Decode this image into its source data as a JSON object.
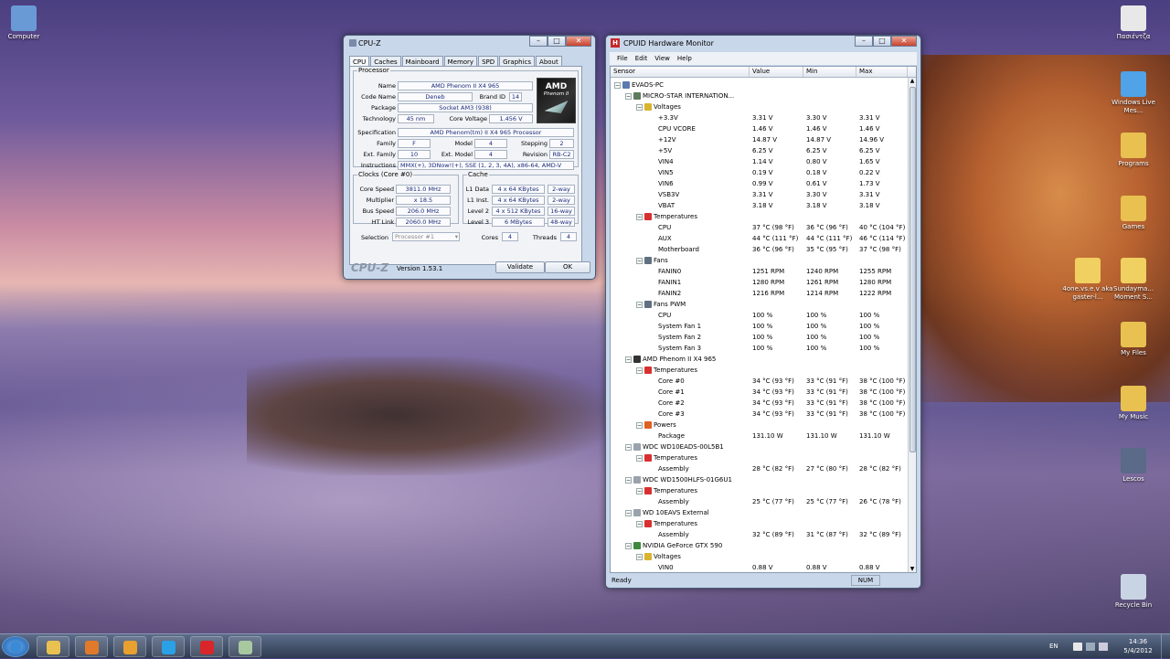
{
  "desktop": {
    "icons": [
      {
        "label": "Computer",
        "color": "#6a9ad6"
      },
      {
        "label": "Πασιέντζα",
        "color": "#e8e8e8"
      },
      {
        "label": "Windows Live Mes...",
        "color": "#4fa3e6"
      },
      {
        "label": "Programs",
        "color": "#e8c150"
      },
      {
        "label": "Games",
        "color": "#e8c150"
      },
      {
        "label": "4one.vs.e.v aka gaster-l...",
        "color": "#f0d060"
      },
      {
        "label": "Sundayma... Moment S...",
        "color": "#f0d060"
      },
      {
        "label": "My Files",
        "color": "#e8c150"
      },
      {
        "label": "My Music",
        "color": "#e8c150"
      },
      {
        "label": "Lescos",
        "color": "#5a6a88"
      },
      {
        "label": "Recycle Bin",
        "color": "#c8d4e4"
      }
    ]
  },
  "cpuz": {
    "title": "CPU-Z",
    "tabs": [
      "CPU",
      "Caches",
      "Mainboard",
      "Memory",
      "SPD",
      "Graphics",
      "About"
    ],
    "processor_legend": "Processor",
    "labels": {
      "name": "Name",
      "code_name": "Code Name",
      "brand_id": "Brand ID",
      "package": "Package",
      "technology": "Technology",
      "core_voltage": "Core Voltage",
      "specification": "Specification",
      "family": "Family",
      "model": "Model",
      "stepping": "Stepping",
      "ext_family": "Ext. Family",
      "ext_model": "Ext. Model",
      "revision": "Revision",
      "instructions": "Instructions"
    },
    "values": {
      "name": "AMD Phenom II X4 965",
      "code_name": "Deneb",
      "brand_id": "14",
      "package": "Socket AM3 (938)",
      "technology": "45 nm",
      "core_voltage": "1.456 V",
      "specification": "AMD Phenom(tm) II X4 965 Processor",
      "family": "F",
      "model": "4",
      "stepping": "2",
      "ext_family": "10",
      "ext_model": "4",
      "revision": "RB-C2",
      "instructions": "MMX(+), 3DNow!(+), SSE (1, 2, 3, 4A), x86-64, AMD-V"
    },
    "logo": {
      "line1": "AMD",
      "line2": "Phenom II"
    },
    "clocks_legend": "Clocks (Core #0)",
    "clock_labels": {
      "core_speed": "Core Speed",
      "multiplier": "Multiplier",
      "bus_speed": "Bus Speed",
      "ht_link": "HT Link"
    },
    "clock_values": {
      "core_speed": "3811.0 MHz",
      "multiplier": "x 18.5",
      "bus_speed": "206.0 MHz",
      "ht_link": "2060.0 MHz"
    },
    "cache_legend": "Cache",
    "cache_rows": [
      {
        "label": "L1 Data",
        "size": "4 x 64 KBytes",
        "way": "2-way"
      },
      {
        "label": "L1 Inst.",
        "size": "4 x 64 KBytes",
        "way": "2-way"
      },
      {
        "label": "Level 2",
        "size": "4 x 512 KBytes",
        "way": "16-way"
      },
      {
        "label": "Level 3",
        "size": "6 MBytes",
        "way": "48-way"
      }
    ],
    "selection_label": "Selection",
    "selection_value": "Processor #1",
    "cores_label": "Cores",
    "cores_value": "4",
    "threads_label": "Threads",
    "threads_value": "4",
    "brand": "CPU-Z",
    "version": "Version 1.53.1",
    "validate": "Validate",
    "ok": "OK"
  },
  "hwmon": {
    "title": "CPUID Hardware Monitor",
    "menu": [
      "File",
      "Edit",
      "View",
      "Help"
    ],
    "columns": [
      "Sensor",
      "Value",
      "Min",
      "Max"
    ],
    "rows": [
      {
        "level": 0,
        "type": "computer",
        "sensor": "EVAOS-PC",
        "value": "",
        "min": "",
        "max": ""
      },
      {
        "level": 1,
        "type": "board",
        "sensor": "MICRO-STAR INTERNATION...",
        "value": "",
        "min": "",
        "max": ""
      },
      {
        "level": 2,
        "type": "volt",
        "sensor": "Voltages",
        "value": "",
        "min": "",
        "max": ""
      },
      {
        "level": 3,
        "type": "",
        "sensor": "+3.3V",
        "value": "3.31 V",
        "min": "3.30 V",
        "max": "3.31 V"
      },
      {
        "level": 3,
        "type": "",
        "sensor": "CPU VCORE",
        "value": "1.46 V",
        "min": "1.46 V",
        "max": "1.46 V"
      },
      {
        "level": 3,
        "type": "",
        "sensor": "+12V",
        "value": "14.87 V",
        "min": "14.87 V",
        "max": "14.96 V"
      },
      {
        "level": 3,
        "type": "",
        "sensor": "+5V",
        "value": "6.25 V",
        "min": "6.25 V",
        "max": "6.25 V"
      },
      {
        "level": 3,
        "type": "",
        "sensor": "VIN4",
        "value": "1.14 V",
        "min": "0.80 V",
        "max": "1.65 V"
      },
      {
        "level": 3,
        "type": "",
        "sensor": "VIN5",
        "value": "0.19 V",
        "min": "0.18 V",
        "max": "0.22 V"
      },
      {
        "level": 3,
        "type": "",
        "sensor": "VIN6",
        "value": "0.99 V",
        "min": "0.61 V",
        "max": "1.73 V"
      },
      {
        "level": 3,
        "type": "",
        "sensor": "VSB3V",
        "value": "3.31 V",
        "min": "3.30 V",
        "max": "3.31 V"
      },
      {
        "level": 3,
        "type": "",
        "sensor": "VBAT",
        "value": "3.18 V",
        "min": "3.18 V",
        "max": "3.18 V"
      },
      {
        "level": 2,
        "type": "temp",
        "sensor": "Temperatures",
        "value": "",
        "min": "",
        "max": ""
      },
      {
        "level": 3,
        "type": "",
        "sensor": "CPU",
        "value": "37 °C  (98 °F)",
        "min": "36 °C  (96 °F)",
        "max": "40 °C  (104 °F)"
      },
      {
        "level": 3,
        "type": "",
        "sensor": "AUX",
        "value": "44 °C  (111 °F)",
        "min": "44 °C  (111 °F)",
        "max": "46 °C  (114 °F)"
      },
      {
        "level": 3,
        "type": "",
        "sensor": "Motherboard",
        "value": "36 °C  (96 °F)",
        "min": "35 °C  (95 °F)",
        "max": "37 °C  (98 °F)"
      },
      {
        "level": 2,
        "type": "fan",
        "sensor": "Fans",
        "value": "",
        "min": "",
        "max": ""
      },
      {
        "level": 3,
        "type": "",
        "sensor": "FANIN0",
        "value": "1251 RPM",
        "min": "1240 RPM",
        "max": "1255 RPM"
      },
      {
        "level": 3,
        "type": "",
        "sensor": "FANIN1",
        "value": "1280 RPM",
        "min": "1261 RPM",
        "max": "1280 RPM"
      },
      {
        "level": 3,
        "type": "",
        "sensor": "FANIN2",
        "value": "1216 RPM",
        "min": "1214 RPM",
        "max": "1222 RPM"
      },
      {
        "level": 2,
        "type": "fan",
        "sensor": "Fans PWM",
        "value": "",
        "min": "",
        "max": ""
      },
      {
        "level": 3,
        "type": "",
        "sensor": "CPU",
        "value": "100 %",
        "min": "100 %",
        "max": "100 %"
      },
      {
        "level": 3,
        "type": "",
        "sensor": "System Fan 1",
        "value": "100 %",
        "min": "100 %",
        "max": "100 %"
      },
      {
        "level": 3,
        "type": "",
        "sensor": "System Fan 2",
        "value": "100 %",
        "min": "100 %",
        "max": "100 %"
      },
      {
        "level": 3,
        "type": "",
        "sensor": "System Fan 3",
        "value": "100 %",
        "min": "100 %",
        "max": "100 %"
      },
      {
        "level": 1,
        "type": "chip",
        "sensor": "AMD Phenom II X4 965",
        "value": "",
        "min": "",
        "max": ""
      },
      {
        "level": 2,
        "type": "temp",
        "sensor": "Temperatures",
        "value": "",
        "min": "",
        "max": ""
      },
      {
        "level": 3,
        "type": "",
        "sensor": "Core #0",
        "value": "34 °C  (93 °F)",
        "min": "33 °C  (91 °F)",
        "max": "38 °C  (100 °F)"
      },
      {
        "level": 3,
        "type": "",
        "sensor": "Core #1",
        "value": "34 °C  (93 °F)",
        "min": "33 °C  (91 °F)",
        "max": "38 °C  (100 °F)"
      },
      {
        "level": 3,
        "type": "",
        "sensor": "Core #2",
        "value": "34 °C  (93 °F)",
        "min": "33 °C  (91 °F)",
        "max": "38 °C  (100 °F)"
      },
      {
        "level": 3,
        "type": "",
        "sensor": "Core #3",
        "value": "34 °C  (93 °F)",
        "min": "33 °C  (91 °F)",
        "max": "38 °C  (100 °F)"
      },
      {
        "level": 2,
        "type": "power",
        "sensor": "Powers",
        "value": "",
        "min": "",
        "max": ""
      },
      {
        "level": 3,
        "type": "",
        "sensor": "Package",
        "value": "131.10 W",
        "min": "131.10 W",
        "max": "131.10 W"
      },
      {
        "level": 1,
        "type": "disk",
        "sensor": "WDC WD10EADS-00L5B1",
        "value": "",
        "min": "",
        "max": ""
      },
      {
        "level": 2,
        "type": "temp",
        "sensor": "Temperatures",
        "value": "",
        "min": "",
        "max": ""
      },
      {
        "level": 3,
        "type": "",
        "sensor": "Assembly",
        "value": "28 °C  (82 °F)",
        "min": "27 °C  (80 °F)",
        "max": "28 °C  (82 °F)"
      },
      {
        "level": 1,
        "type": "disk",
        "sensor": "WDC WD1500HLFS-01G6U1",
        "value": "",
        "min": "",
        "max": ""
      },
      {
        "level": 2,
        "type": "temp",
        "sensor": "Temperatures",
        "value": "",
        "min": "",
        "max": ""
      },
      {
        "level": 3,
        "type": "",
        "sensor": "Assembly",
        "value": "25 °C  (77 °F)",
        "min": "25 °C  (77 °F)",
        "max": "26 °C  (78 °F)"
      },
      {
        "level": 1,
        "type": "disk",
        "sensor": "WD 10EAVS External",
        "value": "",
        "min": "",
        "max": ""
      },
      {
        "level": 2,
        "type": "temp",
        "sensor": "Temperatures",
        "value": "",
        "min": "",
        "max": ""
      },
      {
        "level": 3,
        "type": "",
        "sensor": "Assembly",
        "value": "32 °C  (89 °F)",
        "min": "31 °C  (87 °F)",
        "max": "32 °C  (89 °F)"
      },
      {
        "level": 1,
        "type": "gpu",
        "sensor": "NVIDIA GeForce GTX 590",
        "value": "",
        "min": "",
        "max": ""
      },
      {
        "level": 2,
        "type": "volt",
        "sensor": "Voltages",
        "value": "",
        "min": "",
        "max": ""
      },
      {
        "level": 3,
        "type": "",
        "sensor": "VIN0",
        "value": "0.88 V",
        "min": "0.88 V",
        "max": "0.88 V"
      }
    ],
    "status_left": "Ready",
    "status_num": "NUM"
  },
  "taskbar": {
    "apps": [
      {
        "name": "start",
        "color": "#3a8ad6"
      },
      {
        "name": "explorer",
        "color": "#e8c150"
      },
      {
        "name": "firefox",
        "color": "#e07a2a"
      },
      {
        "name": "winamp",
        "color": "#e8a030"
      },
      {
        "name": "skype",
        "color": "#2aa0e6"
      },
      {
        "name": "flashget",
        "color": "#d8262a"
      },
      {
        "name": "app",
        "color": "#a8c8a0"
      }
    ],
    "lang": "EN",
    "time": "14:36",
    "date": "5/4/2012"
  }
}
